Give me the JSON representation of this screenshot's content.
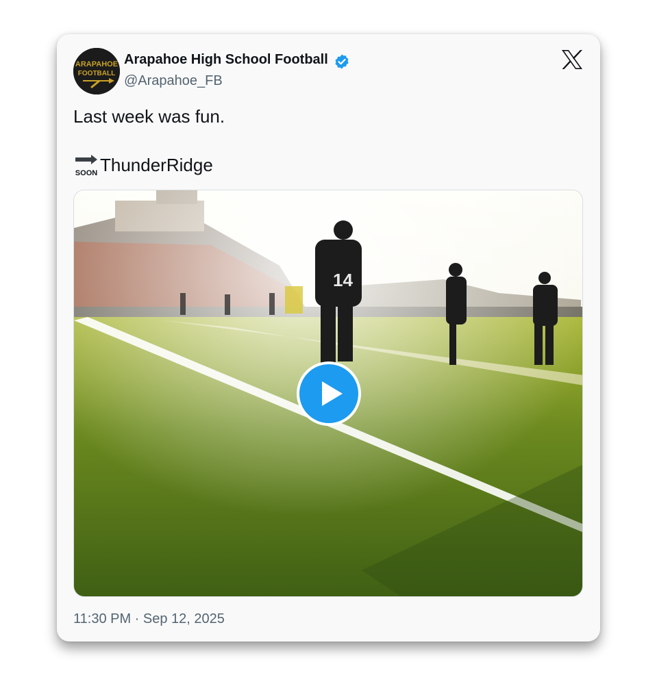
{
  "author": {
    "name": "Arapahoe High School Football",
    "handle": "@Arapahoe_FB",
    "verified": true,
    "avatar_text_line1": "ARAPAHOE",
    "avatar_text_line2": "FOOTBALL"
  },
  "tweet": {
    "line1": "Last week was fun.",
    "soon_emoji_label": "SOON",
    "line2": "ThunderRidge"
  },
  "media": {
    "type": "video",
    "play_icon": "play-icon"
  },
  "timestamp": "11:30 PM · Sep 12, 2025",
  "icons": {
    "platform": "x-logo-icon",
    "verified": "verified-badge-icon",
    "soon": "soon-arrow-icon"
  },
  "colors": {
    "accent": "#1d9bf0",
    "text": "#0f1419",
    "secondary_text": "#536471",
    "avatar_gold": "#c9a227",
    "card_bg": "#f9f9f9"
  }
}
